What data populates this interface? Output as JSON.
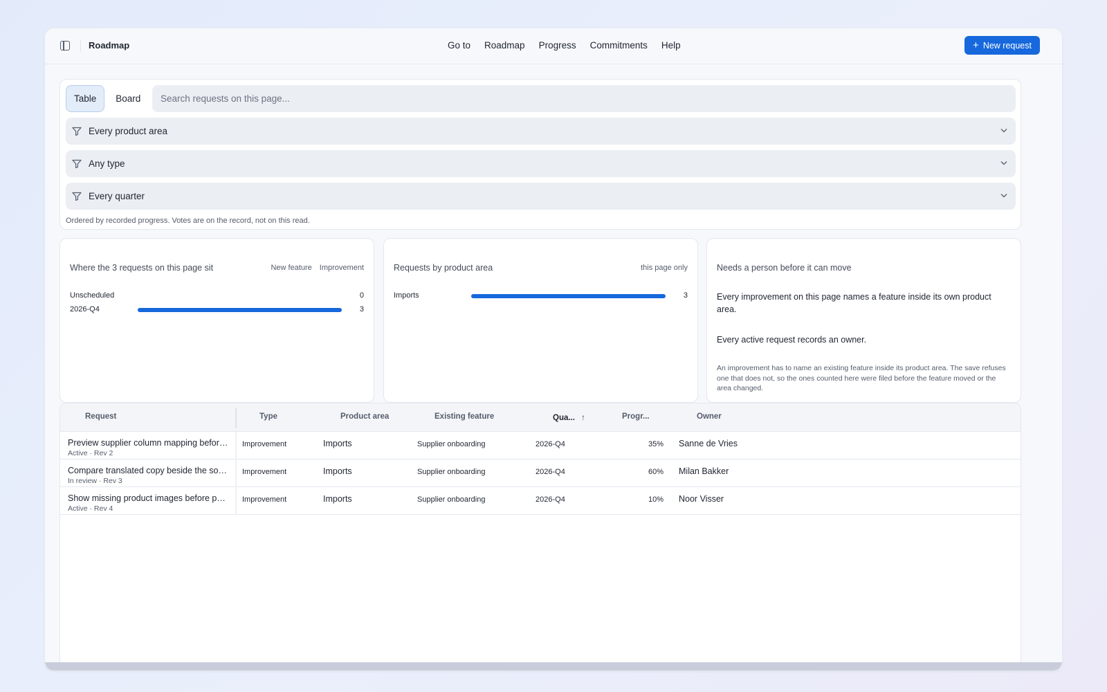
{
  "header": {
    "title": "Roadmap",
    "nav": [
      "Go to",
      "Roadmap",
      "Progress",
      "Commitments",
      "Help"
    ],
    "new_request_label": "New request"
  },
  "filters": {
    "views": [
      "Table",
      "Board"
    ],
    "active_view": "Table",
    "search_placeholder": "Search requests on this page...",
    "product_area": "Every product area",
    "type": "Any type",
    "quarter": "Every quarter",
    "note": "Ordered by recorded progress. Votes are on the record, not on this read."
  },
  "quarter_card": {
    "title": "Where the 3 requests on this page sit",
    "legend": [
      "New feature",
      "Improvement"
    ],
    "rows": [
      {
        "label": "Unscheduled",
        "count": 0,
        "fraction": 0
      },
      {
        "label": "2026-Q4",
        "count": 3,
        "fraction": 1
      }
    ]
  },
  "area_card": {
    "title": "Requests by product area",
    "scope": "this page only",
    "rows": [
      {
        "label": "Imports",
        "count": 3,
        "fraction": 1
      }
    ]
  },
  "notice_card": {
    "title": "Needs a person before it can move",
    "items": [
      "Every improvement on this page names a feature inside its own product area.",
      "Every active request records an owner."
    ],
    "footnote": "An improvement has to name an existing feature inside its product area. The save refuses one that does not, so the ones counted here were filed before the feature moved or the area changed."
  },
  "table": {
    "columns": {
      "request": "Request",
      "type": "Type",
      "area": "Product area",
      "feature": "Existing feature",
      "quarter": "Qua...",
      "progress": "Progr...",
      "owner": "Owner"
    },
    "rows": [
      {
        "title": "Preview supplier column mapping before import",
        "status": "Active · Rev 2",
        "type": "Improvement",
        "area": "Imports",
        "feature": "Supplier onboarding",
        "quarter": "2026-Q4",
        "progress": "35%",
        "owner": "Sanne de Vries"
      },
      {
        "title": "Compare translated copy beside the source",
        "status": "In review · Rev 3",
        "type": "Improvement",
        "area": "Imports",
        "feature": "Supplier onboarding",
        "quarter": "2026-Q4",
        "progress": "60%",
        "owner": "Milan Bakker"
      },
      {
        "title": "Show missing product images before publishing",
        "status": "Active · Rev 4",
        "type": "Improvement",
        "area": "Imports",
        "feature": "Supplier onboarding",
        "quarter": "2026-Q4",
        "progress": "10%",
        "owner": "Noor Visser"
      }
    ]
  }
}
